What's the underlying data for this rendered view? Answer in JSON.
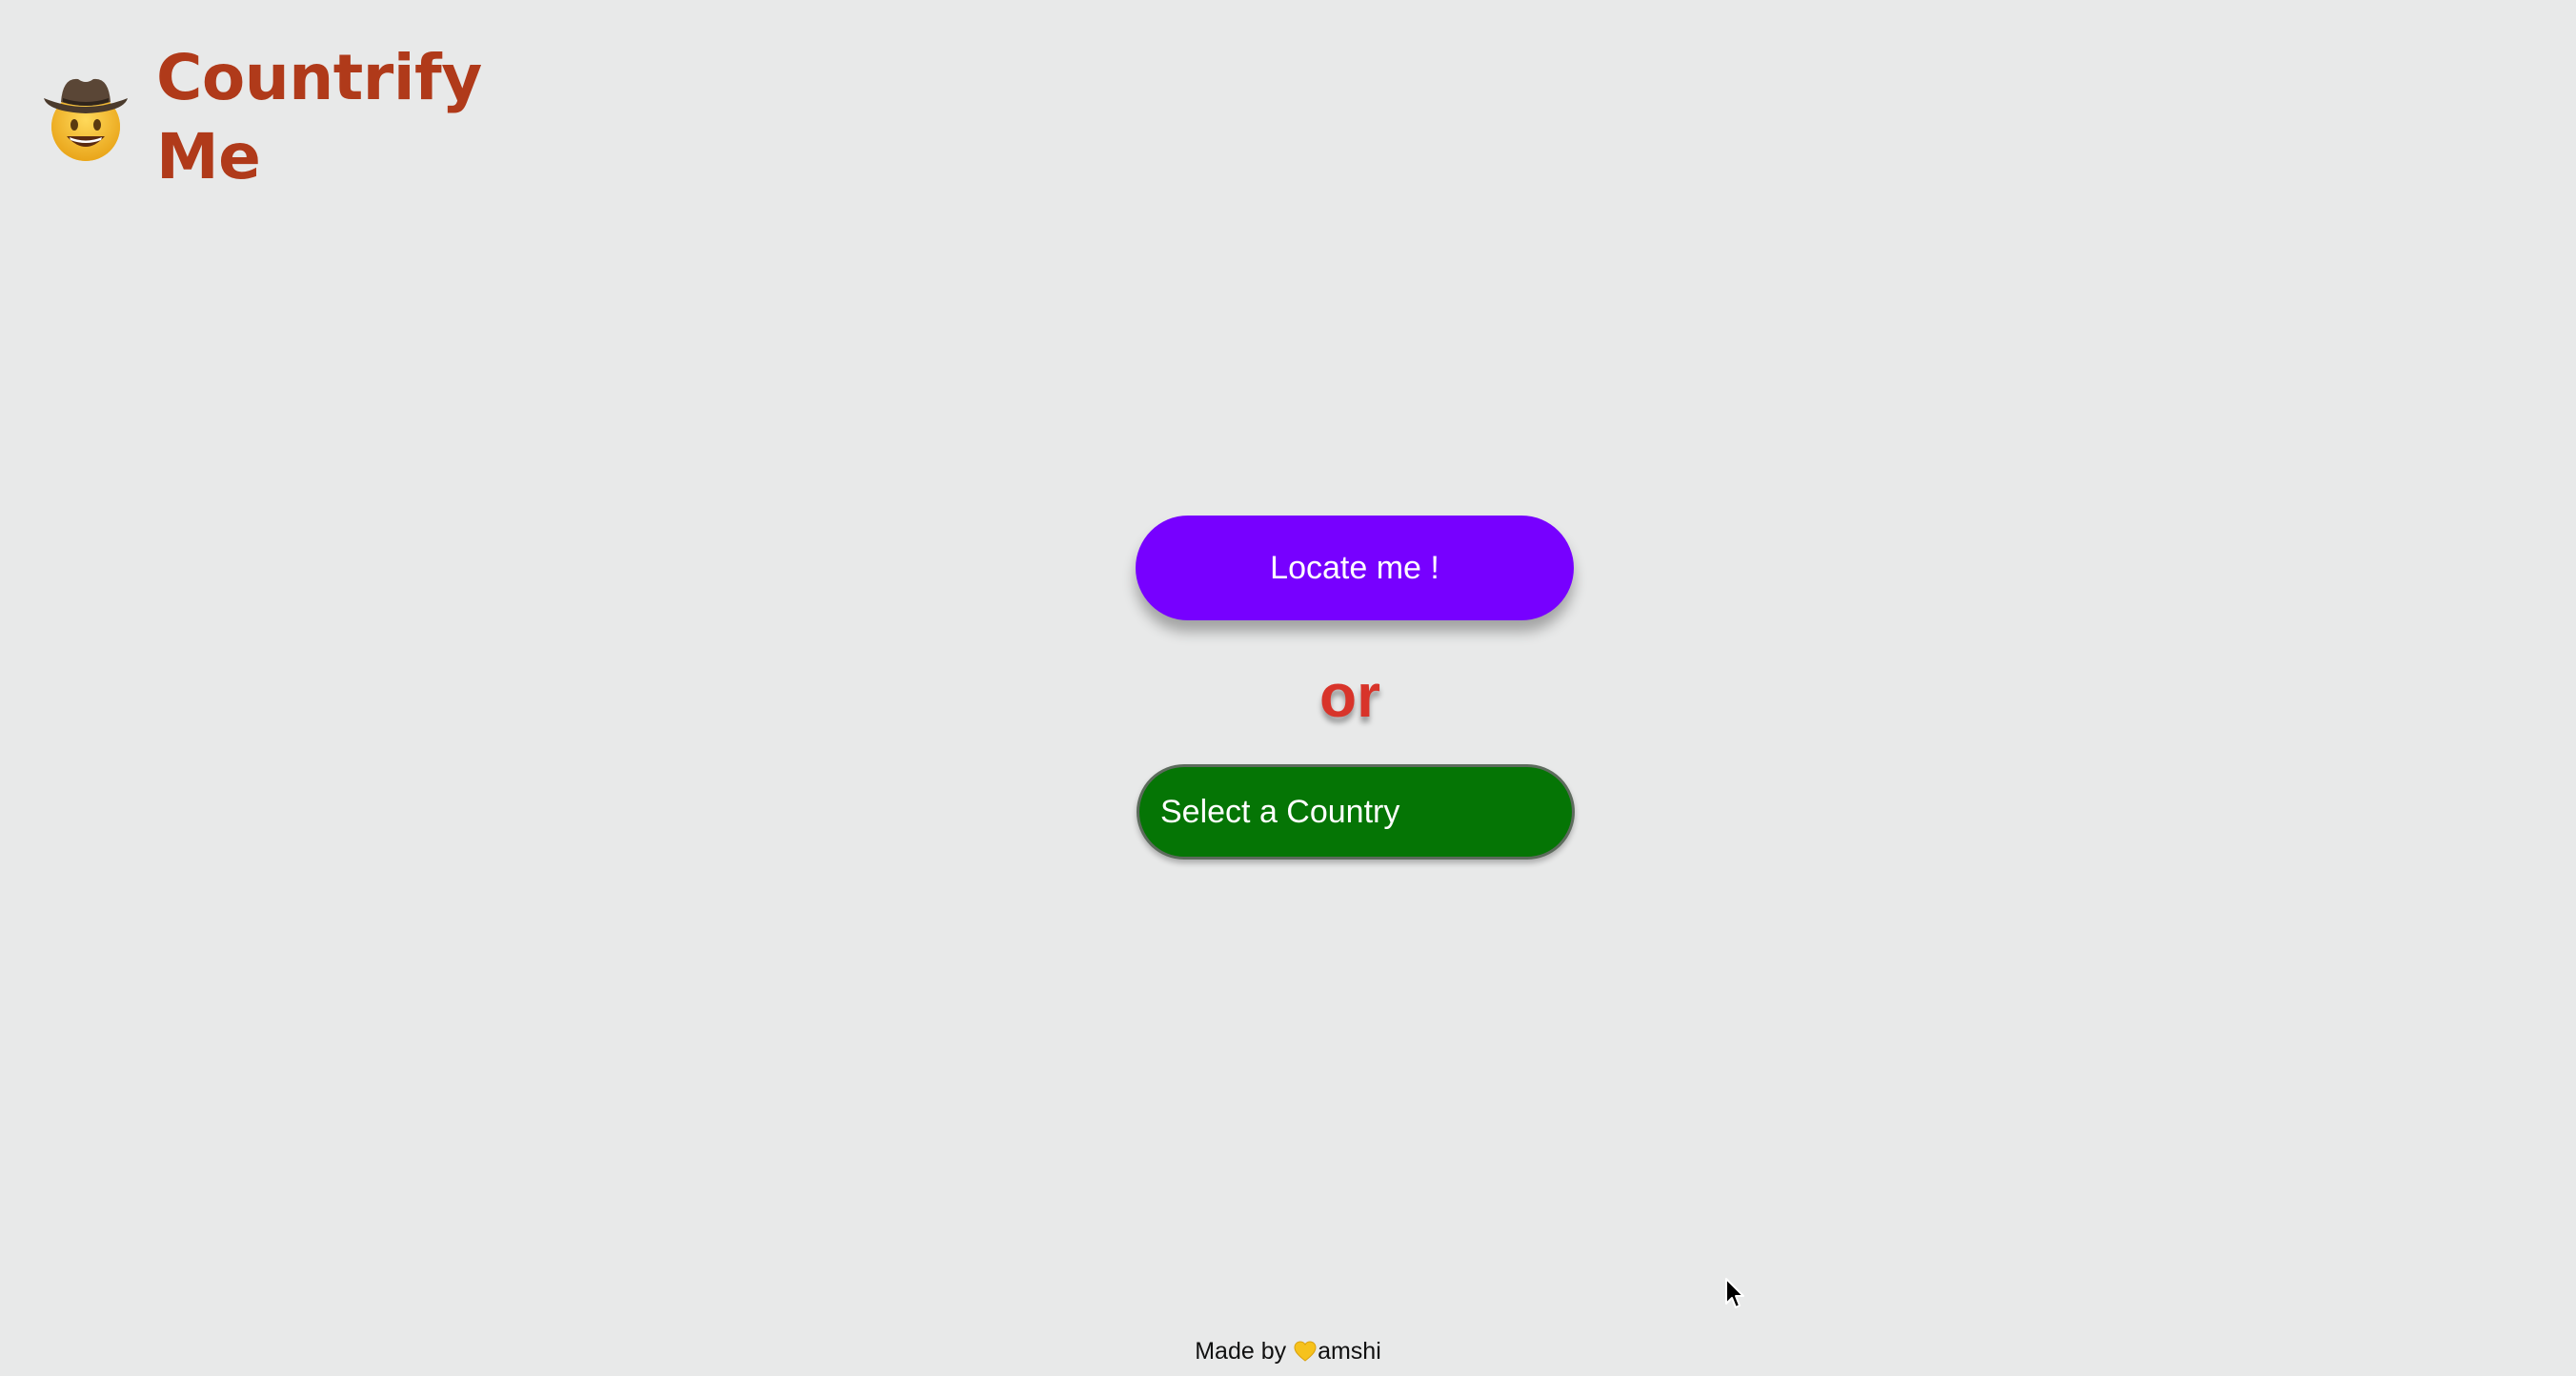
{
  "header": {
    "logo_icon": "cowboy-emoji-icon",
    "title_line1": "Countrify",
    "title_line2": "Me"
  },
  "main": {
    "locate_button_label": "Locate me !",
    "or_text": "or",
    "select_button_label": "Select a Country"
  },
  "footer": {
    "prefix": "Made by ",
    "heart_icon": "yellow-heart-icon",
    "suffix": "amshi"
  },
  "colors": {
    "title": "#b03a1a",
    "locate_button": "#7700ff",
    "select_button": "#057505",
    "or_text": "#d8342a",
    "background": "#e8e9e9"
  }
}
